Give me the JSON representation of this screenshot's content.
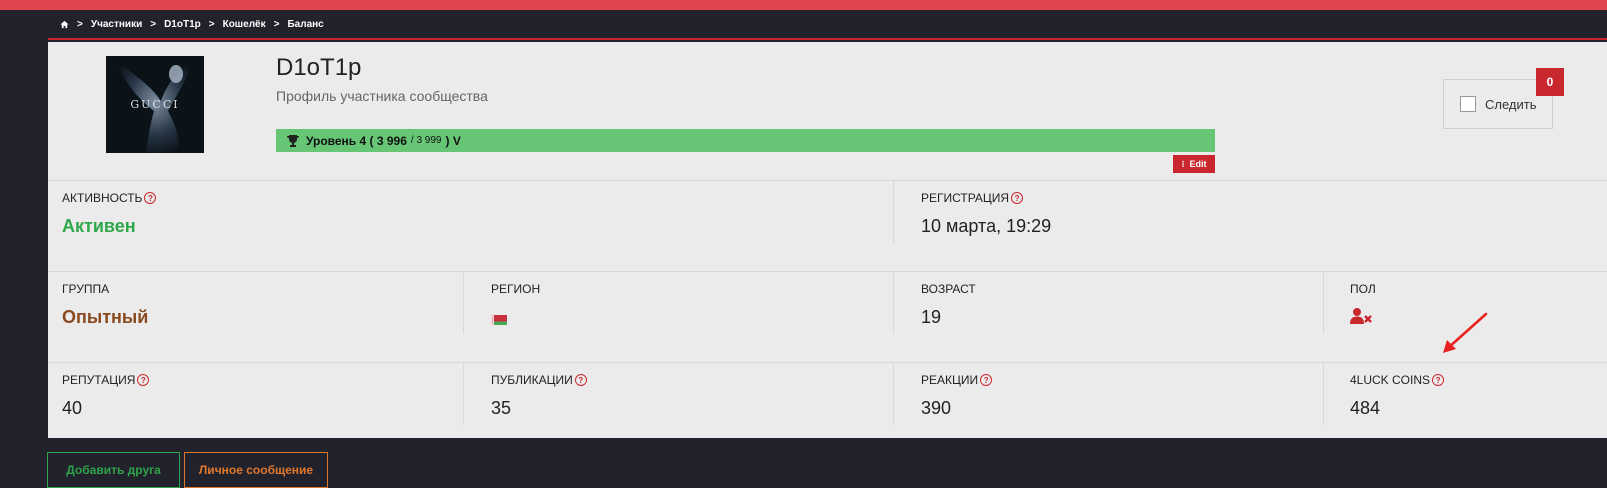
{
  "breadcrumb": {
    "items": [
      "Участники",
      "D1oT1p",
      "Кошелёк",
      "Баланс"
    ],
    "separator": ">"
  },
  "profile": {
    "avatar_wordmark": "GUCCI",
    "username": "D1oT1p",
    "subtitle": "Профиль участника сообщества"
  },
  "level": {
    "prefix": "Уровень 4 ( 3 996",
    "max": "/ 3 999",
    "suffix": ") V",
    "progress": 0.999
  },
  "edit_label": "Edit",
  "follow": {
    "label": "Следить",
    "count": "0"
  },
  "stats": {
    "activity": {
      "label": "АКТИВНОСТЬ",
      "value": "Активен"
    },
    "registration": {
      "label": "РЕГИСТРАЦИЯ",
      "value": "10 марта, 19:29"
    },
    "group": {
      "label": "ГРУППА",
      "value": "Опытный"
    },
    "region": {
      "label": "РЕГИОН"
    },
    "age": {
      "label": "ВОЗРАСТ",
      "value": "19"
    },
    "gender": {
      "label": "ПОЛ"
    },
    "reputation": {
      "label": "РЕПУТАЦИЯ",
      "value": "40"
    },
    "publications": {
      "label": "ПУБЛИКАЦИИ",
      "value": "35"
    },
    "reactions": {
      "label": "РЕАКЦИИ",
      "value": "390"
    },
    "coins": {
      "label": "4LUCK COINS",
      "value": "484"
    }
  },
  "help_glyph": "?",
  "actions": {
    "add_friend": "Добавить друга",
    "message": "Личное сообщение"
  },
  "colors": {
    "accent_red": "#c8272d",
    "level_green": "#66c676",
    "active_green": "#2ea84a",
    "group_brown": "#8a4a20",
    "message_orange": "#e0782c"
  }
}
